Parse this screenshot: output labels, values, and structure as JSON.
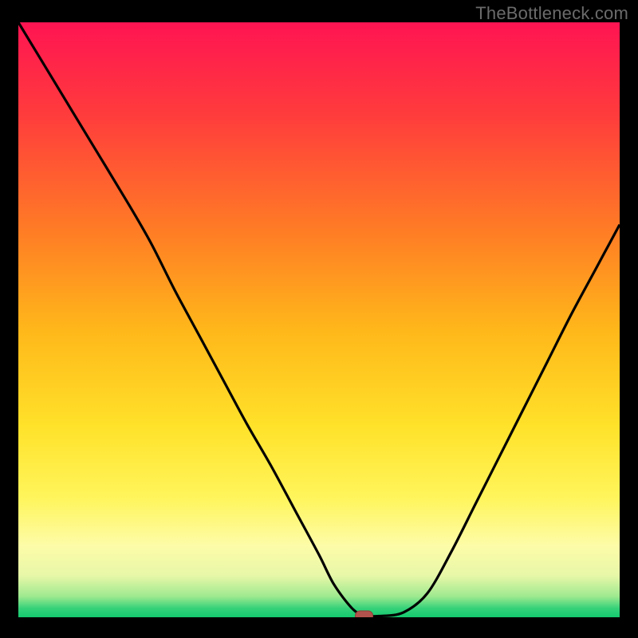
{
  "watermark": "TheBottleneck.com",
  "colors": {
    "background": "#000000",
    "frame": "#000000",
    "curve": "#000000",
    "marker_fill": "#b2524c",
    "marker_stroke": "#8f3d38",
    "gradient_stops": [
      {
        "offset": 0.0,
        "color": "#ff1452"
      },
      {
        "offset": 0.15,
        "color": "#ff3a3d"
      },
      {
        "offset": 0.35,
        "color": "#ff7c25"
      },
      {
        "offset": 0.52,
        "color": "#ffb81a"
      },
      {
        "offset": 0.68,
        "color": "#ffe22a"
      },
      {
        "offset": 0.8,
        "color": "#fff55c"
      },
      {
        "offset": 0.88,
        "color": "#fdfca8"
      },
      {
        "offset": 0.93,
        "color": "#e7f7a8"
      },
      {
        "offset": 0.965,
        "color": "#9ee98f"
      },
      {
        "offset": 0.985,
        "color": "#35d27a"
      },
      {
        "offset": 1.0,
        "color": "#14c96f"
      }
    ]
  },
  "plot": {
    "inner_x": 23,
    "inner_y": 28,
    "inner_w": 754,
    "inner_h": 746,
    "frame_stroke_w": 46
  },
  "chart_data": {
    "type": "line",
    "title": "",
    "xlabel": "",
    "ylabel": "",
    "xlim": [
      0,
      100
    ],
    "ylim": [
      0,
      100
    ],
    "series": [
      {
        "name": "bottleneck-curve",
        "x": [
          0,
          6,
          12,
          18,
          22,
          26,
          30,
          34,
          38,
          42,
          46,
          50,
          52.5,
          55.5,
          57.5,
          60,
          64,
          68,
          72,
          76,
          80,
          84,
          88,
          92,
          96,
          100
        ],
        "y": [
          100,
          90,
          80,
          70,
          63,
          55,
          47.5,
          40,
          32.5,
          25.5,
          18,
          10.5,
          5.5,
          1.5,
          0.3,
          0.2,
          0.8,
          4,
          11,
          19,
          27,
          35,
          43,
          51,
          58.5,
          66
        ]
      }
    ],
    "marker": {
      "x": 57.5,
      "y": 0.2
    }
  }
}
